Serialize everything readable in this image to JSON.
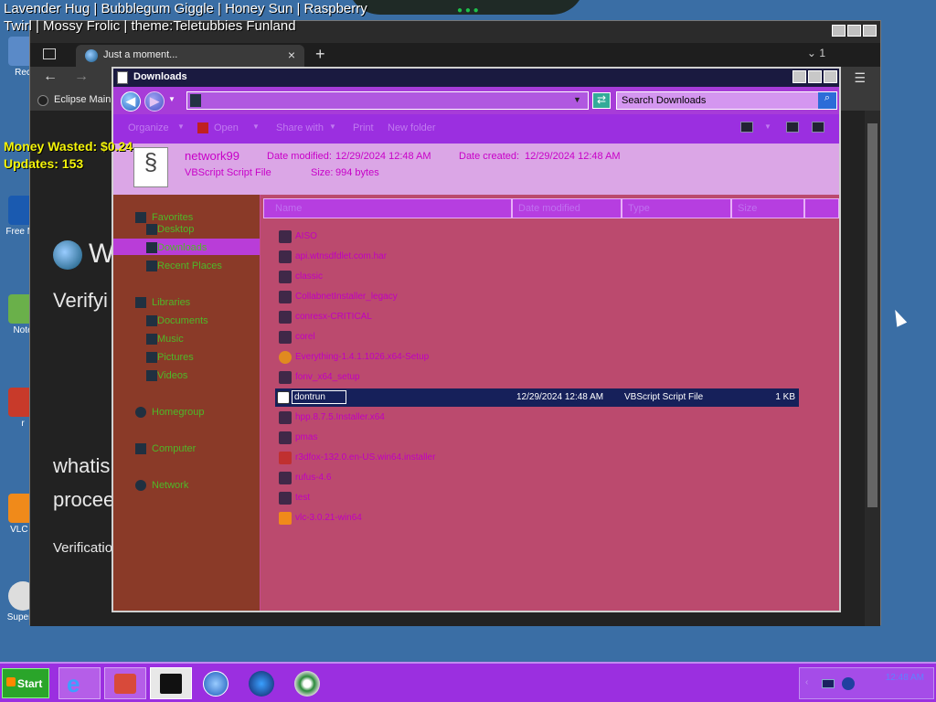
{
  "overlay": {
    "title": "Lavender Hug | Bubblegum Giggle | Honey Sun | Raspberry Twirl | Mossy Frolic | theme:Teletubbies Funland",
    "money": "Money Wasted: $0.24",
    "updates": "Updates: 153"
  },
  "desktop": {
    "icons": [
      {
        "label": "Rec",
        "icon": "recycle-bin-icon"
      },
      {
        "label": "Free Ma",
        "icon": "app-icon"
      },
      {
        "label": "Note",
        "icon": "notepad-icon"
      },
      {
        "label": "r",
        "icon": "app-icon"
      },
      {
        "label": "VLC p",
        "icon": "vlc-icon"
      },
      {
        "label": "Super...",
        "icon": "app-icon"
      }
    ]
  },
  "browser": {
    "tab_title": "Just a moment...",
    "tabs_count": "1",
    "bookmark": "Eclipse Main S",
    "page": {
      "heading": "W",
      "sub": "Verifyi",
      "para1": "whatis",
      "para2": "procee",
      "footer": "Verificatio"
    }
  },
  "explorer": {
    "title": "Downloads",
    "address": "",
    "search_placeholder": "Search Downloads",
    "toolbar": [
      "Organize",
      "Open",
      "Share with",
      "Print",
      "New folder"
    ],
    "details": {
      "name": "network99",
      "type": "VBScript Script File",
      "modified_label": "Date modified:",
      "modified": "12/29/2024 12:48 AM",
      "created_label": "Date created:",
      "created": "12/29/2024 12:48 AM",
      "size_label": "Size:",
      "size": "994 bytes"
    },
    "nav": [
      {
        "label": "Favorites",
        "icon": "star-icon"
      },
      {
        "label": "Desktop",
        "icon": "desktop-icon"
      },
      {
        "label": "Downloads",
        "icon": "downloads-icon"
      },
      {
        "label": "Recent Places",
        "icon": "recent-icon"
      },
      {
        "label": "Libraries",
        "icon": "library-icon"
      },
      {
        "label": "Documents",
        "icon": "documents-icon"
      },
      {
        "label": "Music",
        "icon": "music-icon"
      },
      {
        "label": "Pictures",
        "icon": "pictures-icon"
      },
      {
        "label": "Videos",
        "icon": "videos-icon"
      },
      {
        "label": "Homegroup",
        "icon": "homegroup-icon"
      },
      {
        "label": "Computer",
        "icon": "computer-icon"
      },
      {
        "label": "Network",
        "icon": "network-icon"
      }
    ],
    "columns": [
      "Name",
      "Date modified",
      "Type",
      "Size"
    ],
    "files": [
      {
        "name": "AISO",
        "date": "",
        "type": "",
        "size": ""
      },
      {
        "name": "api.wtnsdfdlet.com.har",
        "date": "",
        "type": "",
        "size": ""
      },
      {
        "name": "classic",
        "date": "",
        "type": "",
        "size": ""
      },
      {
        "name": "CollabnetInstaller_legacy",
        "date": "",
        "type": "",
        "size": ""
      },
      {
        "name": "conresx-CRITICAL",
        "date": "",
        "type": "",
        "size": ""
      },
      {
        "name": "corel",
        "date": "",
        "type": "",
        "size": ""
      },
      {
        "name": "Everything-1.4.1.1026.x64-Setup",
        "date": "",
        "type": "",
        "size": ""
      },
      {
        "name": "fonv_x64_setup",
        "date": "",
        "type": "",
        "size": ""
      },
      {
        "name": "dontrun",
        "date": "12/29/2024 12:48 AM",
        "type": "VBScript Script File",
        "size": "1 KB"
      },
      {
        "name": "hpp.8.7.5.Installer.x64",
        "date": "",
        "type": "",
        "size": ""
      },
      {
        "name": "pmas",
        "date": "",
        "type": "",
        "size": ""
      },
      {
        "name": "r3dfox-132.0.en-US.win64.installer",
        "date": "",
        "type": "",
        "size": ""
      },
      {
        "name": "rufus-4.6",
        "date": "",
        "type": "",
        "size": ""
      },
      {
        "name": "test",
        "date": "",
        "type": "",
        "size": ""
      },
      {
        "name": "vlc-3.0.21-win64",
        "date": "",
        "type": "",
        "size": ""
      }
    ]
  },
  "taskbar": {
    "start_label": "Start",
    "apps": [
      "internet-explorer-icon",
      "app-icon",
      "terminal-icon",
      "media-player-icon",
      "firefox-icon",
      "chrome-icon"
    ],
    "tray_time": "12:48 AM"
  },
  "colors": {
    "explorer_bg": "#c64a8f",
    "taskbar": "#9b2fe0",
    "nav_pane": "#8a3a28",
    "selected_row": "#16205a"
  }
}
